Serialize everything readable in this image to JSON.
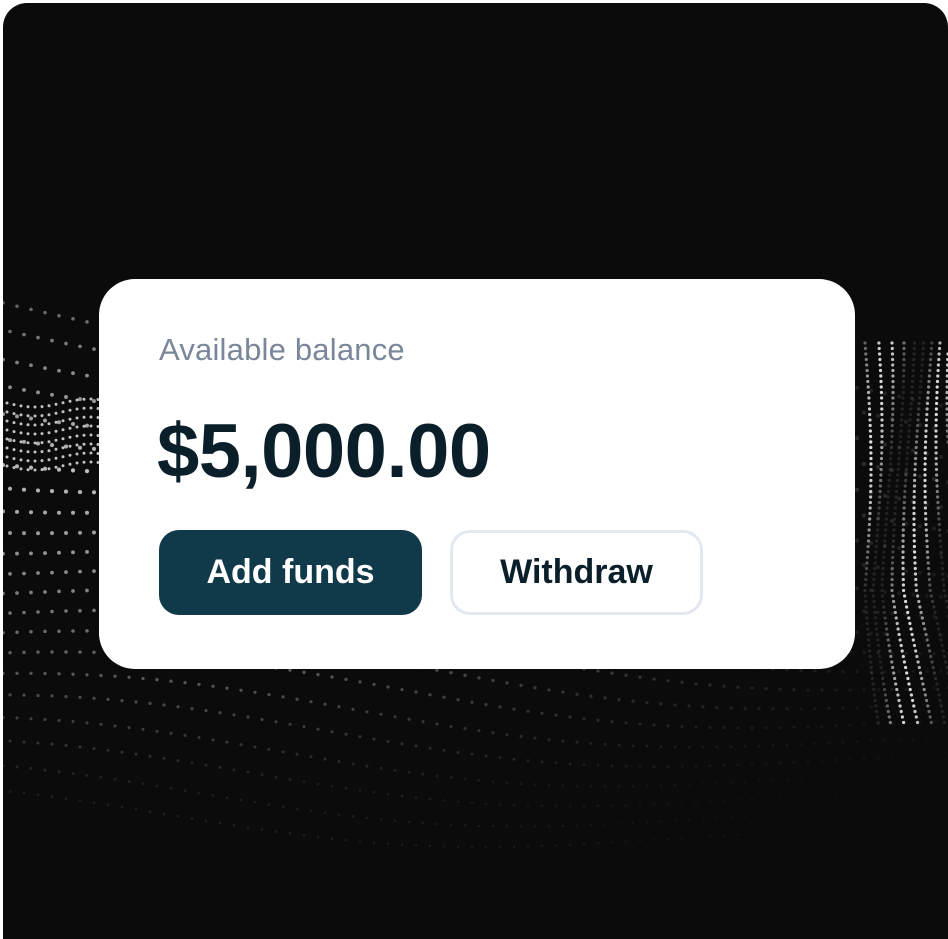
{
  "balance_card": {
    "label": "Available balance",
    "amount": "$5,000.00",
    "add_funds_label": "Add funds",
    "withdraw_label": "Withdraw"
  },
  "colors": {
    "background": "#0b0b0b",
    "card": "#ffffff",
    "primary_button": "#10394a",
    "label_text": "#7a8699",
    "amount_text": "#0b1f2a",
    "secondary_border": "#e1e8f0"
  }
}
